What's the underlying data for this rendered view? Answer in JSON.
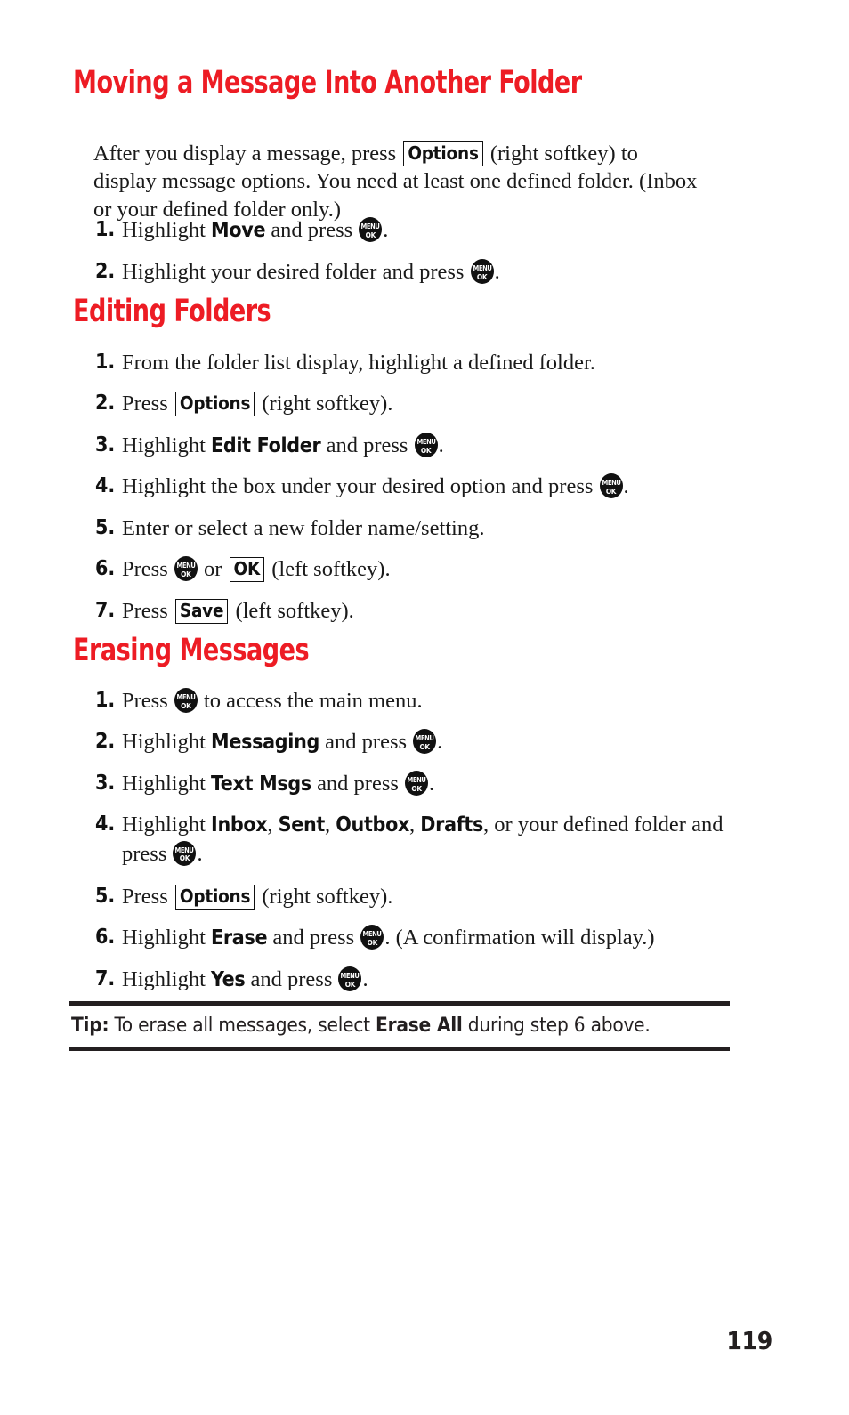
{
  "page": {
    "number": "119",
    "accent_color": "#ED1C24",
    "text_color": "#1a1a1a",
    "rule_color": "#231f20",
    "background": "#ffffff"
  },
  "icons": {
    "menu_ok": {
      "top": "MENU",
      "bottom": "OK",
      "name": "menu-ok-key-icon"
    }
  },
  "sections": [
    {
      "id": "moving",
      "heading": "Moving a Message Into Another Folder",
      "intro": {
        "part1": "After you display a message, press ",
        "softkey": "Options",
        "part2": " (right softkey) to display message options. You need at least one defined folder. (Inbox or your defined folder only.)"
      },
      "steps": [
        {
          "num": "1.",
          "part1": "Highlight ",
          "bold": "Move",
          "part2": " and press ",
          "part3": "."
        },
        {
          "num": "2.",
          "part1": "Highlight your desired folder and press ",
          "part3": "."
        }
      ]
    },
    {
      "id": "editing",
      "heading": "Editing Folders",
      "steps": [
        {
          "num": "1.",
          "part1": "From the folder list display, highlight a defined folder."
        },
        {
          "num": "2.",
          "part1": "Press ",
          "softkey": "Options",
          "part2": " (right softkey)."
        },
        {
          "num": "3.",
          "part1": "Highlight ",
          "bold": "Edit Folder",
          "part2": " and press ",
          "part3": "."
        },
        {
          "num": "4.",
          "part1": "Highlight the box under your desired option and press ",
          "part3": "."
        },
        {
          "num": "5.",
          "part1": "Enter or select a new folder name/setting."
        },
        {
          "num": "6.",
          "part1": "Press ",
          "mid": " or ",
          "softkey": "OK",
          "part2": " (left softkey)."
        },
        {
          "num": "7.",
          "part1": "Press ",
          "softkey": "Save",
          "part2": " (left softkey)."
        }
      ]
    },
    {
      "id": "erasing",
      "heading": "Erasing Messages",
      "steps": [
        {
          "num": "1.",
          "part1": "Press ",
          "part3": " to access the main menu."
        },
        {
          "num": "2.",
          "part1": "Highlight ",
          "bold": "Messaging",
          "part2": " and press ",
          "part3": "."
        },
        {
          "num": "3.",
          "part1": "Highlight ",
          "bold": "Text Msgs",
          "part2": " and press ",
          "part3": "."
        },
        {
          "num": "4.",
          "part1": "Highlight ",
          "bold_a": "Inbox",
          "sep_a": ", ",
          "bold_b": "Sent",
          "sep_b": ", ",
          "bold_c": "Outbox",
          "sep_c": ", ",
          "bold_d": "Drafts",
          "part2": ", or your defined folder and press ",
          "part3": "."
        },
        {
          "num": "5.",
          "part1": "Press ",
          "softkey": "Options",
          "part2": " (right softkey)."
        },
        {
          "num": "6.",
          "part1": "Highlight ",
          "bold": "Erase",
          "part2": " and press ",
          "part3": ". (A confirmation will display.)"
        },
        {
          "num": "7.",
          "part1": "Highlight ",
          "bold": "Yes",
          "part2": " and press ",
          "part3": "."
        }
      ]
    }
  ],
  "tip": {
    "label": "Tip:",
    "text_before": " To erase all messages, select ",
    "strong": "Erase All",
    "text_after": " during step 6 above."
  }
}
